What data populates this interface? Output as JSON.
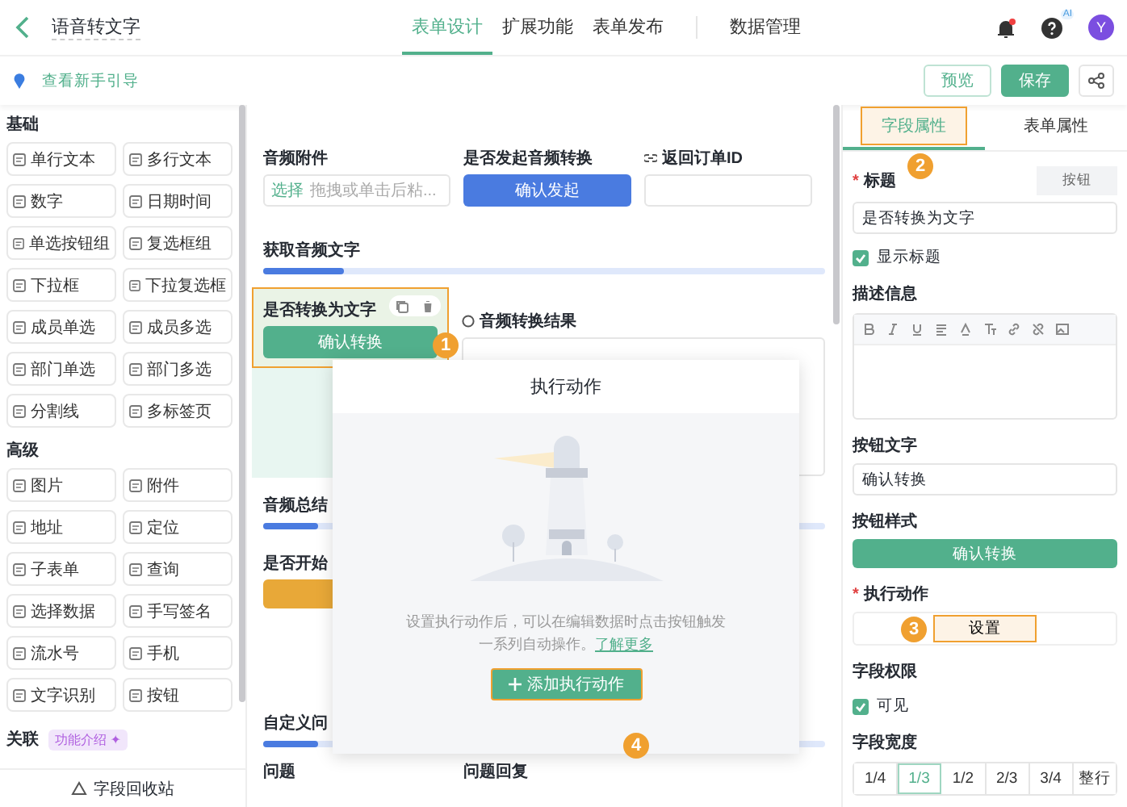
{
  "header": {
    "title": "语音转文字",
    "tabs": [
      {
        "label": "表单设计",
        "selected": true
      },
      {
        "label": "扩展功能",
        "selected": false
      },
      {
        "label": "表单发布",
        "selected": false
      },
      {
        "label": "数据管理",
        "selected": false
      }
    ],
    "ai_badge": "AI",
    "avatar": "Y"
  },
  "toolbar": {
    "guide_link": "查看新手引导",
    "buttons": [
      {
        "label": "预览",
        "kind": "outline"
      },
      {
        "label": "保存",
        "kind": "primary"
      }
    ]
  },
  "palette": {
    "sections": [
      {
        "title": "基础",
        "items": [
          "单行文本",
          "多行文本",
          "数字",
          "日期时间",
          "单选按钮组",
          "复选框组",
          "下拉框",
          "下拉复选框",
          "成员单选",
          "成员多选",
          "部门单选",
          "部门多选",
          "分割线",
          "多标签页"
        ]
      },
      {
        "title": "高级",
        "items": [
          "图片",
          "附件",
          "地址",
          "定位",
          "子表单",
          "查询",
          "选择数据",
          "手写签名",
          "流水号",
          "手机",
          "文字识别",
          "按钮"
        ]
      }
    ],
    "related": {
      "title": "关联",
      "badge": "功能介绍 ✦"
    },
    "recycle": "字段回收站"
  },
  "canvas": {
    "fields": [
      {
        "label": "音频附件",
        "kind": "upload",
        "action": "选择",
        "hint": "拖拽或单击后粘..."
      },
      {
        "label": "是否发起音频转换",
        "kind": "button",
        "button": "确认发起"
      },
      {
        "label": "返回订单ID",
        "kind": "input"
      }
    ],
    "section_1": "获取音频文字",
    "selected_field": {
      "label": "是否转换为文字",
      "button": "确认转换",
      "highlighted": true
    },
    "result_field": "音频转换结果",
    "section_2": "音频总结",
    "start_field": "是否开始",
    "section_3": "自定义问",
    "bottom_fields": [
      "问题",
      "问题回复"
    ]
  },
  "modal": {
    "title": "执行动作",
    "description": "设置执行动作后，可以在编辑数据时点击按钮触发一系列自动操作。",
    "link": "了解更多",
    "button": "添加执行动作",
    "highlighted": true
  },
  "annotations": [
    "1",
    "2",
    "3",
    "4"
  ],
  "properties": {
    "tabs": [
      {
        "label": "字段属性",
        "selected": true,
        "highlighted": true
      },
      {
        "label": "表单属性",
        "selected": false,
        "highlighted": false
      }
    ],
    "title_field": {
      "required_mark": "*",
      "label": "标题",
      "tag": "按钮",
      "value": "是否转换为文字"
    },
    "show_title": {
      "label": "显示标题",
      "checked": true
    },
    "description": {
      "label": "描述信息"
    },
    "button_text": {
      "label": "按钮文字",
      "value": "确认转换"
    },
    "button_style": {
      "label": "按钮样式",
      "preview": "确认转换"
    },
    "action": {
      "required_mark": "*",
      "label": "执行动作",
      "button": "设置",
      "highlighted": true
    },
    "permission": {
      "label": "字段权限",
      "checkbox": {
        "label": "可见",
        "checked": true
      }
    },
    "width": {
      "label": "字段宽度",
      "options": [
        {
          "label": "1/4",
          "selected": false
        },
        {
          "label": "1/3",
          "selected": true
        },
        {
          "label": "1/2",
          "selected": false
        },
        {
          "label": "2/3",
          "selected": false
        },
        {
          "label": "3/4",
          "selected": false
        },
        {
          "label": "整行",
          "selected": false
        }
      ]
    }
  }
}
